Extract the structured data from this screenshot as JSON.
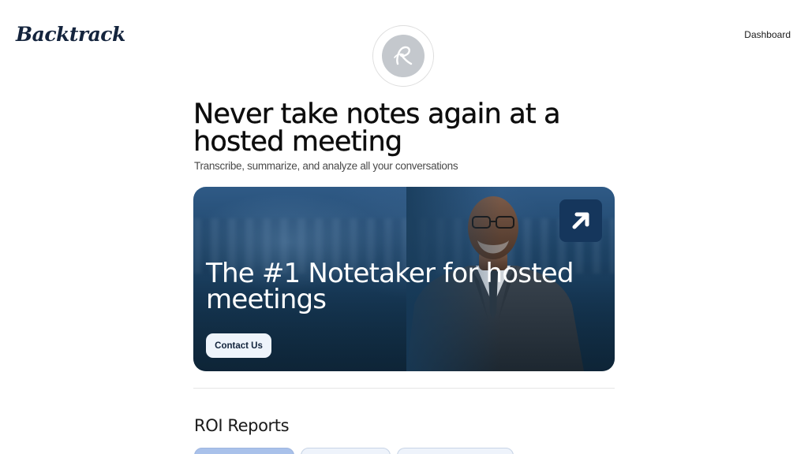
{
  "header": {
    "logo_text": "Backtrack",
    "nav_dashboard": "Dashboard"
  },
  "avatar": {
    "icon": "script-r-monogram-icon"
  },
  "hero": {
    "headline": "Never take notes again at a hosted meeting",
    "subheadline": "Transcribe, summarize, and analyze all your conversations"
  },
  "banner": {
    "title": "The #1 Notetaker for hosted meetings",
    "cta_label": "Contact Us",
    "arrow_icon": "arrow-up-right-icon",
    "colors": {
      "background": "#1f4569",
      "arrow_button": "#15365c",
      "cta_background": "#eef4fb"
    }
  },
  "section": {
    "title": "ROI Reports",
    "tabs": [
      {
        "label": ""
      },
      {
        "label": ""
      },
      {
        "label": ""
      }
    ]
  }
}
